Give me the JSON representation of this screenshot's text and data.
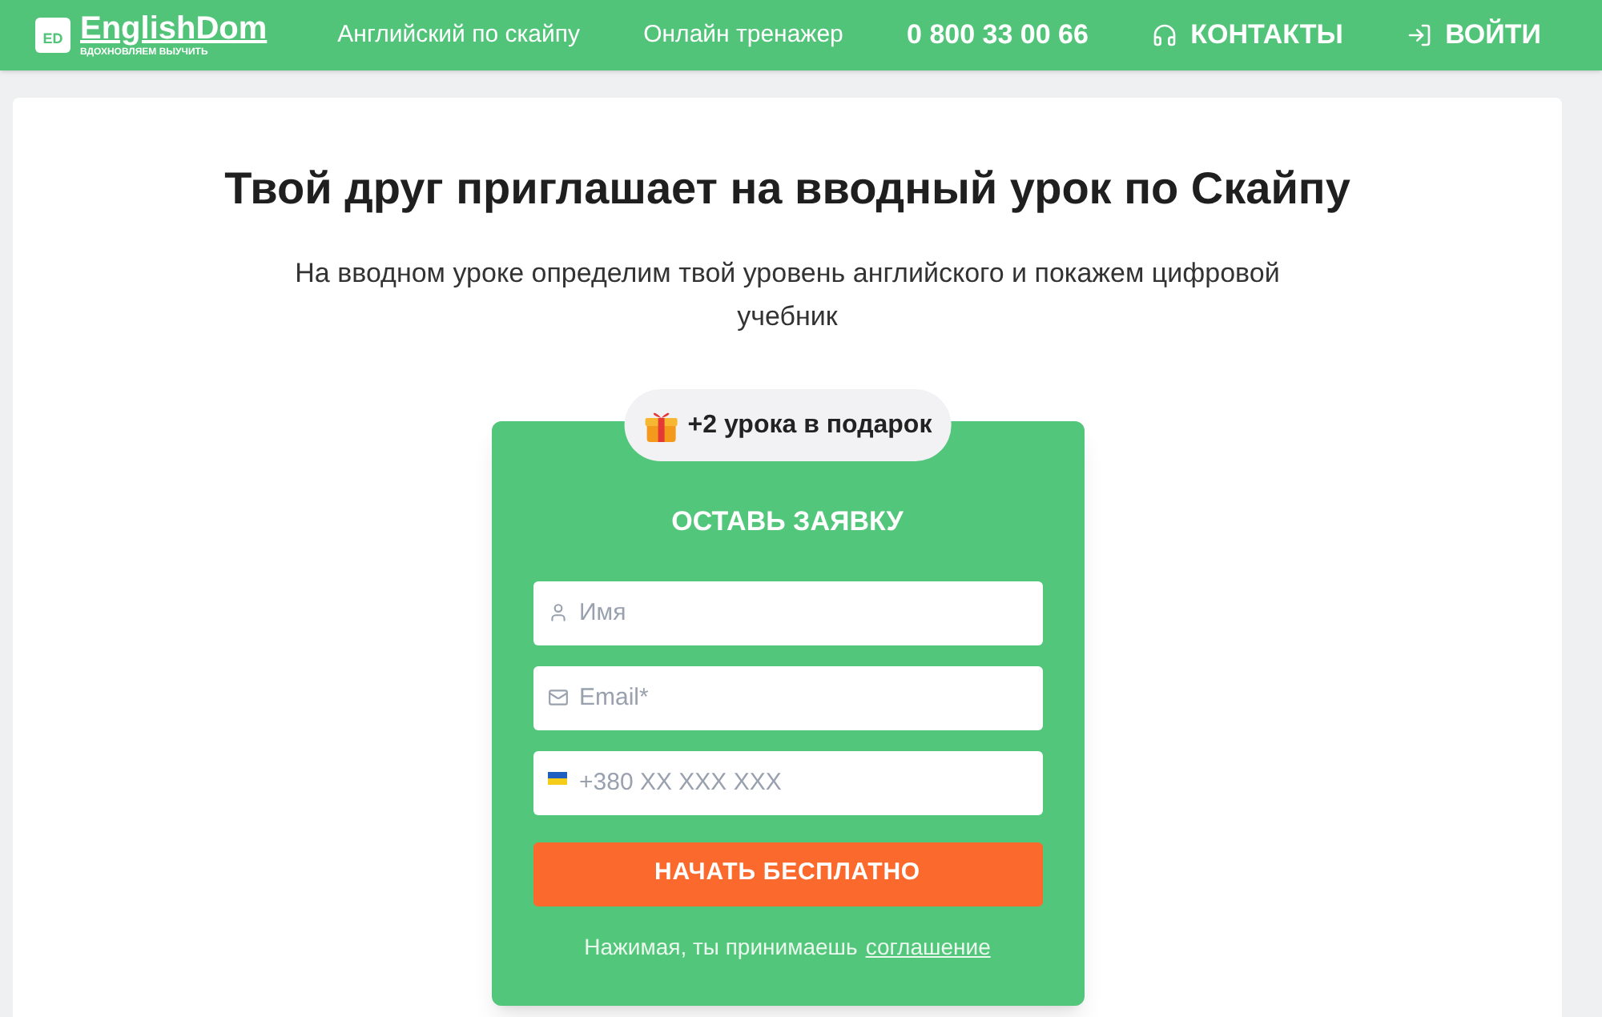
{
  "header": {
    "logo": {
      "mark": "ED",
      "name": "EnglishDom",
      "tagline": "ВДОХНОВЛЯЕМ ВЫУЧИТЬ"
    },
    "nav": [
      {
        "kind": "link",
        "label": "Английский по скайпу"
      },
      {
        "kind": "link",
        "label": "Онлайн тренажер"
      },
      {
        "kind": "phone",
        "label": "0 800 33 00 66"
      },
      {
        "kind": "contacts",
        "label": "КОНТАКТЫ"
      },
      {
        "kind": "login",
        "label": "ВОЙТИ"
      }
    ]
  },
  "title": "Твой друг приглашает на вводный урок по Скайпу",
  "subtitle": "На вводном уроке определим твой уровень английского и покажем цифровой учебник",
  "form": {
    "badge": "+2 урока в подарок",
    "heading": "ОСТАВЬ ЗАЯВКУ",
    "fields": [
      {
        "kind": "name",
        "placeholder": "Имя"
      },
      {
        "kind": "email",
        "placeholder": "Email*"
      },
      {
        "kind": "phone",
        "placeholder": "+380 XX XXX XXX"
      }
    ],
    "submit": "НАЧАТЬ БЕСПЛАТНО",
    "agreement": "Нажимая, ты принимаешь",
    "agreement_link": "соглашение"
  }
}
